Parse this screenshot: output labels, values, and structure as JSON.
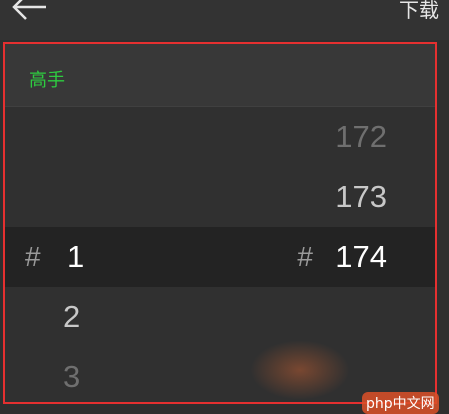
{
  "topbar": {
    "back_icon": "arrow-left-icon",
    "download_label": "下载"
  },
  "section": {
    "title": "高手",
    "title_color": "#2ecc40"
  },
  "picker": {
    "rows": [
      {
        "left": "",
        "right": "172"
      },
      {
        "left": "",
        "right": "173"
      },
      {
        "left_hash": "#",
        "left": "1",
        "right_hash": "#",
        "right": "174"
      },
      {
        "left": "2",
        "right": ""
      },
      {
        "left": "3",
        "right": ""
      }
    ]
  },
  "watermark": {
    "text": "php中文网"
  }
}
